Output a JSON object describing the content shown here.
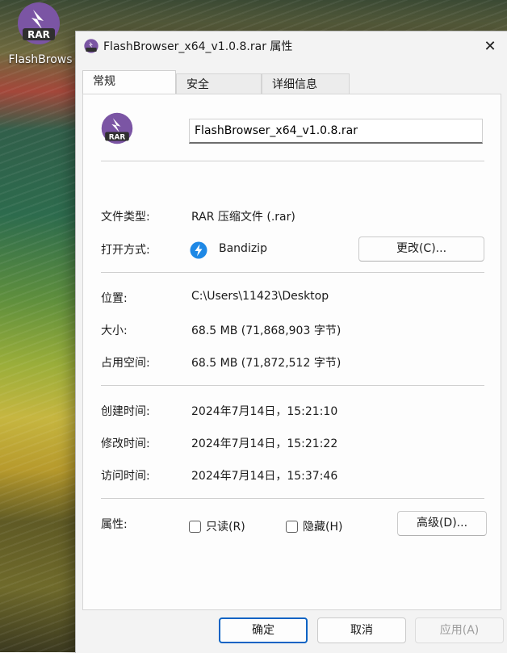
{
  "desktop": {
    "icon_label": "FlashBrows",
    "icon_badge": "RAR"
  },
  "dialog": {
    "title": "FlashBrowser_x64_v1.0.8.rar 属性",
    "close_glyph": "✕",
    "tabs": [
      {
        "label": "常规",
        "active": true
      },
      {
        "label": "安全",
        "active": false
      },
      {
        "label": "详细信息",
        "active": false
      }
    ],
    "file_icon_badge": "RAR",
    "filename": "FlashBrowser_x64_v1.0.8.rar",
    "type_label": "文件类型:",
    "type_value": "RAR 压缩文件 (.rar)",
    "open_with_label": "打开方式:",
    "open_with_app": "Bandizip",
    "change_button": "更改(C)...",
    "location_label": "位置:",
    "location_value": "C:\\Users\\11423\\Desktop",
    "size_label": "大小:",
    "size_value": "68.5 MB (71,868,903 字节)",
    "disk_size_label": "占用空间:",
    "disk_size_value": "68.5 MB (71,872,512 字节)",
    "created_label": "创建时间:",
    "created_value": "2024年7月14日，15:21:10",
    "modified_label": "修改时间:",
    "modified_value": "2024年7月14日，15:21:22",
    "accessed_label": "访问时间:",
    "accessed_value": "2024年7月14日，15:37:46",
    "attributes_label": "属性:",
    "readonly_label": "只读(R)",
    "readonly_checked": false,
    "hidden_label": "隐藏(H)",
    "hidden_checked": false,
    "advanced_button": "高级(D)...",
    "ok_button": "确定",
    "cancel_button": "取消",
    "apply_button": "应用(A)"
  },
  "colors": {
    "rar_purple": "#7b55a4",
    "rar_dark": "#2f2f2f",
    "bandizip_blue": "#1e88e5",
    "accent": "#0a63c4"
  },
  "icons": {
    "rar": "rar-archive-icon",
    "bandizip": "bandizip-icon",
    "close": "close-icon"
  }
}
